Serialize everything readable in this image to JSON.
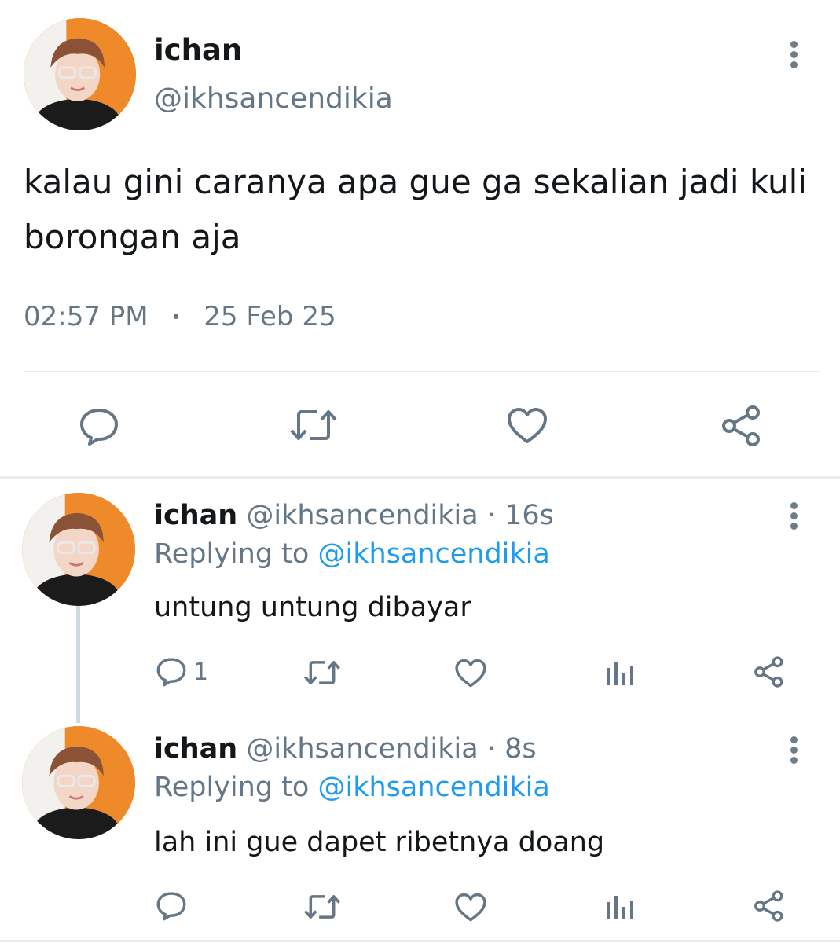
{
  "main_tweet": {
    "display_name": "ichan",
    "handle": "@ikhsancendikia",
    "text_line1": "kalau gini caranya apa gue ga sekalian jadi kuli",
    "text_line2": "borongan aja",
    "time": "02:57 PM",
    "separator": "•",
    "date": "25 Feb 25",
    "actions": [
      "reply-icon",
      "retweet-icon",
      "like-icon",
      "share-icon"
    ]
  },
  "replies": [
    {
      "display_name": "ichan",
      "handle_time": "@ikhsancendikia · 16s",
      "replying_prefix": "Replying to",
      "replying_handle": "@ikhsancendikia",
      "text": "untung untung dibayar",
      "reply_count": "1"
    },
    {
      "display_name": "ichan",
      "handle_time": "@ikhsancendikia · 8s",
      "replying_prefix": "Replying to",
      "replying_handle": "@ikhsancendikia",
      "text": "lah ini gue dapet ribetnya doang",
      "reply_count": ""
    }
  ],
  "colors": {
    "secondary_text": "#657786",
    "link_blue": "#1d9bf0",
    "icon_gray": "#657786",
    "avatar_bg": "#ee8a2a"
  }
}
